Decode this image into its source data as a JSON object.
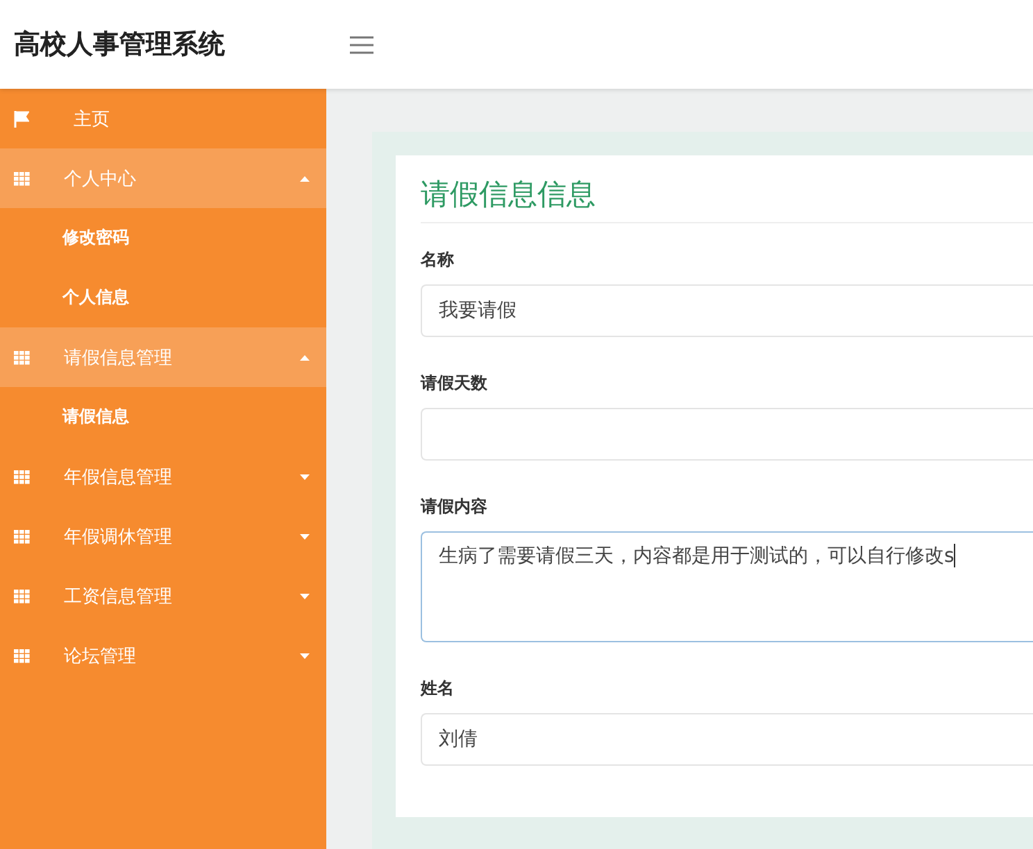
{
  "header": {
    "title": "高校人事管理系统"
  },
  "sidebar": {
    "items": [
      {
        "label": "主页",
        "kind": "link"
      },
      {
        "label": "个人中心",
        "kind": "group",
        "expanded": true,
        "children": [
          {
            "label": "修改密码"
          },
          {
            "label": "个人信息"
          }
        ]
      },
      {
        "label": "请假信息管理",
        "kind": "group",
        "expanded": true,
        "children": [
          {
            "label": "请假信息"
          }
        ]
      },
      {
        "label": "年假信息管理",
        "kind": "group",
        "expanded": false
      },
      {
        "label": "年假调休管理",
        "kind": "group",
        "expanded": false
      },
      {
        "label": "工资信息管理",
        "kind": "group",
        "expanded": false
      },
      {
        "label": "论坛管理",
        "kind": "group",
        "expanded": false
      }
    ]
  },
  "form": {
    "title": "请假信息信息",
    "fields": [
      {
        "label": "名称",
        "kind": "input",
        "value": "我要请假"
      },
      {
        "label": "请假天数",
        "kind": "input"
      },
      {
        "label": "请假内容",
        "kind": "textarea",
        "value": "生病了需要请假三天，内容都是用于测试的，可以自行修改s",
        "focused": true
      },
      {
        "label": "姓名",
        "kind": "input",
        "value": "刘倩"
      }
    ]
  }
}
